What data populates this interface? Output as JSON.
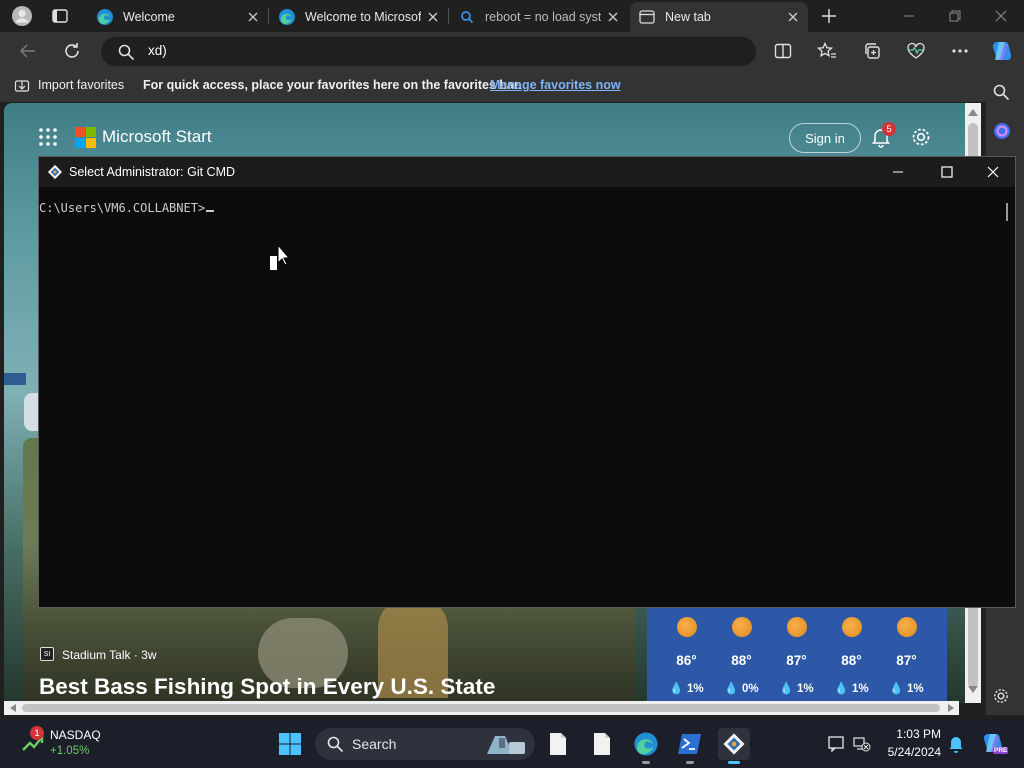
{
  "browser": {
    "tabs": [
      {
        "label": "Welcome",
        "icon": "edge-icon",
        "active": false
      },
      {
        "label": "Welcome to Microsof",
        "icon": "edge-icon",
        "active": false
      },
      {
        "label": "reboot = no load syst",
        "icon": "search-icon",
        "active": false
      },
      {
        "label": "New tab",
        "icon": "new-tab-icon",
        "active": true
      }
    ],
    "address_value": "xd)",
    "favorites_bar": {
      "import_label": "Import favorites",
      "hint": "For quick access, place your favorites here on the favorites bar.",
      "manage_link": "Manage favorites now"
    }
  },
  "msstart": {
    "title": "Microsoft Start",
    "sign_in": "Sign in",
    "notification_count": "5",
    "story": {
      "source": "Stadium Talk · 3w",
      "source_logo": "SI",
      "title": "Best Bass Fishing Spot in Every U.S. State"
    },
    "weather": [
      {
        "temp": "86°",
        "precip": "1%"
      },
      {
        "temp": "88°",
        "precip": "0%"
      },
      {
        "temp": "87°",
        "precip": "1%"
      },
      {
        "temp": "88°",
        "precip": "1%"
      },
      {
        "temp": "87°",
        "precip": "1%"
      }
    ]
  },
  "cmd": {
    "title": "Select Administrator: Git CMD",
    "prompt": "C:\\Users\\VM6.COLLABNET>"
  },
  "taskbar": {
    "stock_name": "NASDAQ",
    "stock_change": "+1.05%",
    "stock_badge": "1",
    "search_label": "Search",
    "time": "1:03 PM",
    "date": "5/24/2024",
    "copilot_badge": "PRE"
  },
  "colors": {
    "link": "#7eb4f7",
    "accent": "#0078d4",
    "weather_bg": "#2d58a8",
    "badge_red": "#d13438",
    "stock_green": "#6ccb5f"
  }
}
